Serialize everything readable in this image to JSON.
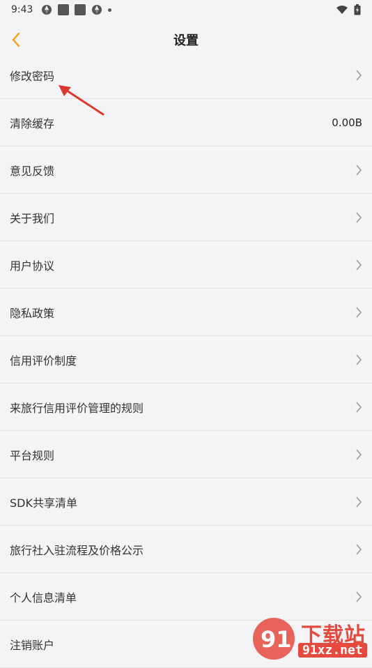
{
  "status_bar": {
    "time": "9:43",
    "icons_left": [
      "aperture-icon",
      "square-icon",
      "square-icon",
      "aperture-icon",
      "dot-icon"
    ],
    "icons_right": [
      "wifi-icon",
      "battery-icon"
    ]
  },
  "nav": {
    "title": "设置",
    "back_icon": "chevron-left-icon",
    "accent_color": "#f5a623"
  },
  "settings": {
    "items": [
      {
        "label": "修改密码",
        "value": "",
        "chevron": true
      },
      {
        "label": "清除缓存",
        "value": "0.00B",
        "chevron": false
      },
      {
        "label": "意见反馈",
        "value": "",
        "chevron": true
      },
      {
        "label": "关于我们",
        "value": "",
        "chevron": true
      },
      {
        "label": "用户协议",
        "value": "",
        "chevron": true
      },
      {
        "label": "隐私政策",
        "value": "",
        "chevron": true
      },
      {
        "label": "信用评价制度",
        "value": "",
        "chevron": true
      },
      {
        "label": "来旅行信用评价管理的规则",
        "value": "",
        "chevron": true
      },
      {
        "label": "平台规则",
        "value": "",
        "chevron": true
      },
      {
        "label": "SDK共享清单",
        "value": "",
        "chevron": true
      },
      {
        "label": "旅行社入驻流程及价格公示",
        "value": "",
        "chevron": true
      },
      {
        "label": "个人信息清单",
        "value": "",
        "chevron": true
      },
      {
        "label": "注销账户",
        "value": "",
        "chevron": false
      }
    ]
  },
  "watermark": {
    "top_text": "下载站",
    "bottom_text": "91xz.net",
    "logo_text": "91"
  }
}
